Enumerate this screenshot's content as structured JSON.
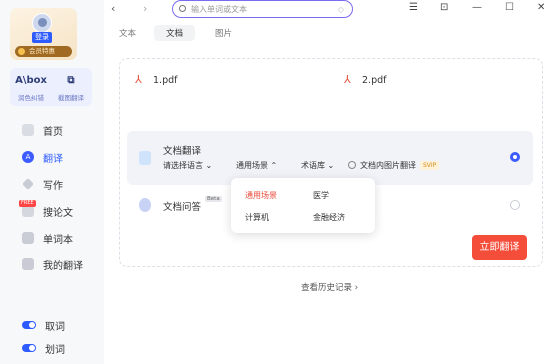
{
  "sidebar": {
    "login_label": "登录",
    "vip_label": "会员特惠",
    "tools": [
      {
        "icon_text": "A\\box",
        "label": "润色纠错"
      },
      {
        "icon_text": "⧉",
        "label": "截图翻译"
      }
    ],
    "nav": [
      {
        "label": "首页",
        "icon": "home-icon"
      },
      {
        "label": "翻译",
        "icon": "translate-icon"
      },
      {
        "label": "写作",
        "icon": "pen-icon"
      },
      {
        "label": "搜论文",
        "icon": "paper-icon",
        "badge": "FREE"
      },
      {
        "label": "单词本",
        "icon": "vocab-icon"
      },
      {
        "label": "我的翻译",
        "icon": "my-translation-icon"
      }
    ],
    "toggles": [
      {
        "label": "取词"
      },
      {
        "label": "划词"
      }
    ]
  },
  "topbar": {
    "search_placeholder": "输入单词或文本",
    "back": "‹",
    "forward": "›",
    "win": {
      "menu": "☰",
      "pin": "⊡",
      "minimize": "—",
      "maximize": "☐",
      "close": "✕"
    }
  },
  "tabs": [
    "文本",
    "文档",
    "图片"
  ],
  "files": [
    "1.pdf",
    "2.pdf"
  ],
  "doc_translate": {
    "title": "文档翻译",
    "lang_select": "请选择语言 ⌄",
    "scene_select": "通用场景 ⌃",
    "termbase": "术语库 ⌄",
    "image_option": "文档内图片翻译",
    "svip": "SVIP"
  },
  "doc_qa": {
    "title": "文档问答",
    "beta": "Beta"
  },
  "scene_dropdown": [
    "通用场景",
    "医学",
    "计算机",
    "金融经济"
  ],
  "actions": {
    "translate_now": "立即翻译",
    "history": "查看历史记录 ›"
  },
  "colors": {
    "accent": "#2e5bff",
    "primary_button": "#f44e3b",
    "selected_option": "#e84a3b"
  }
}
